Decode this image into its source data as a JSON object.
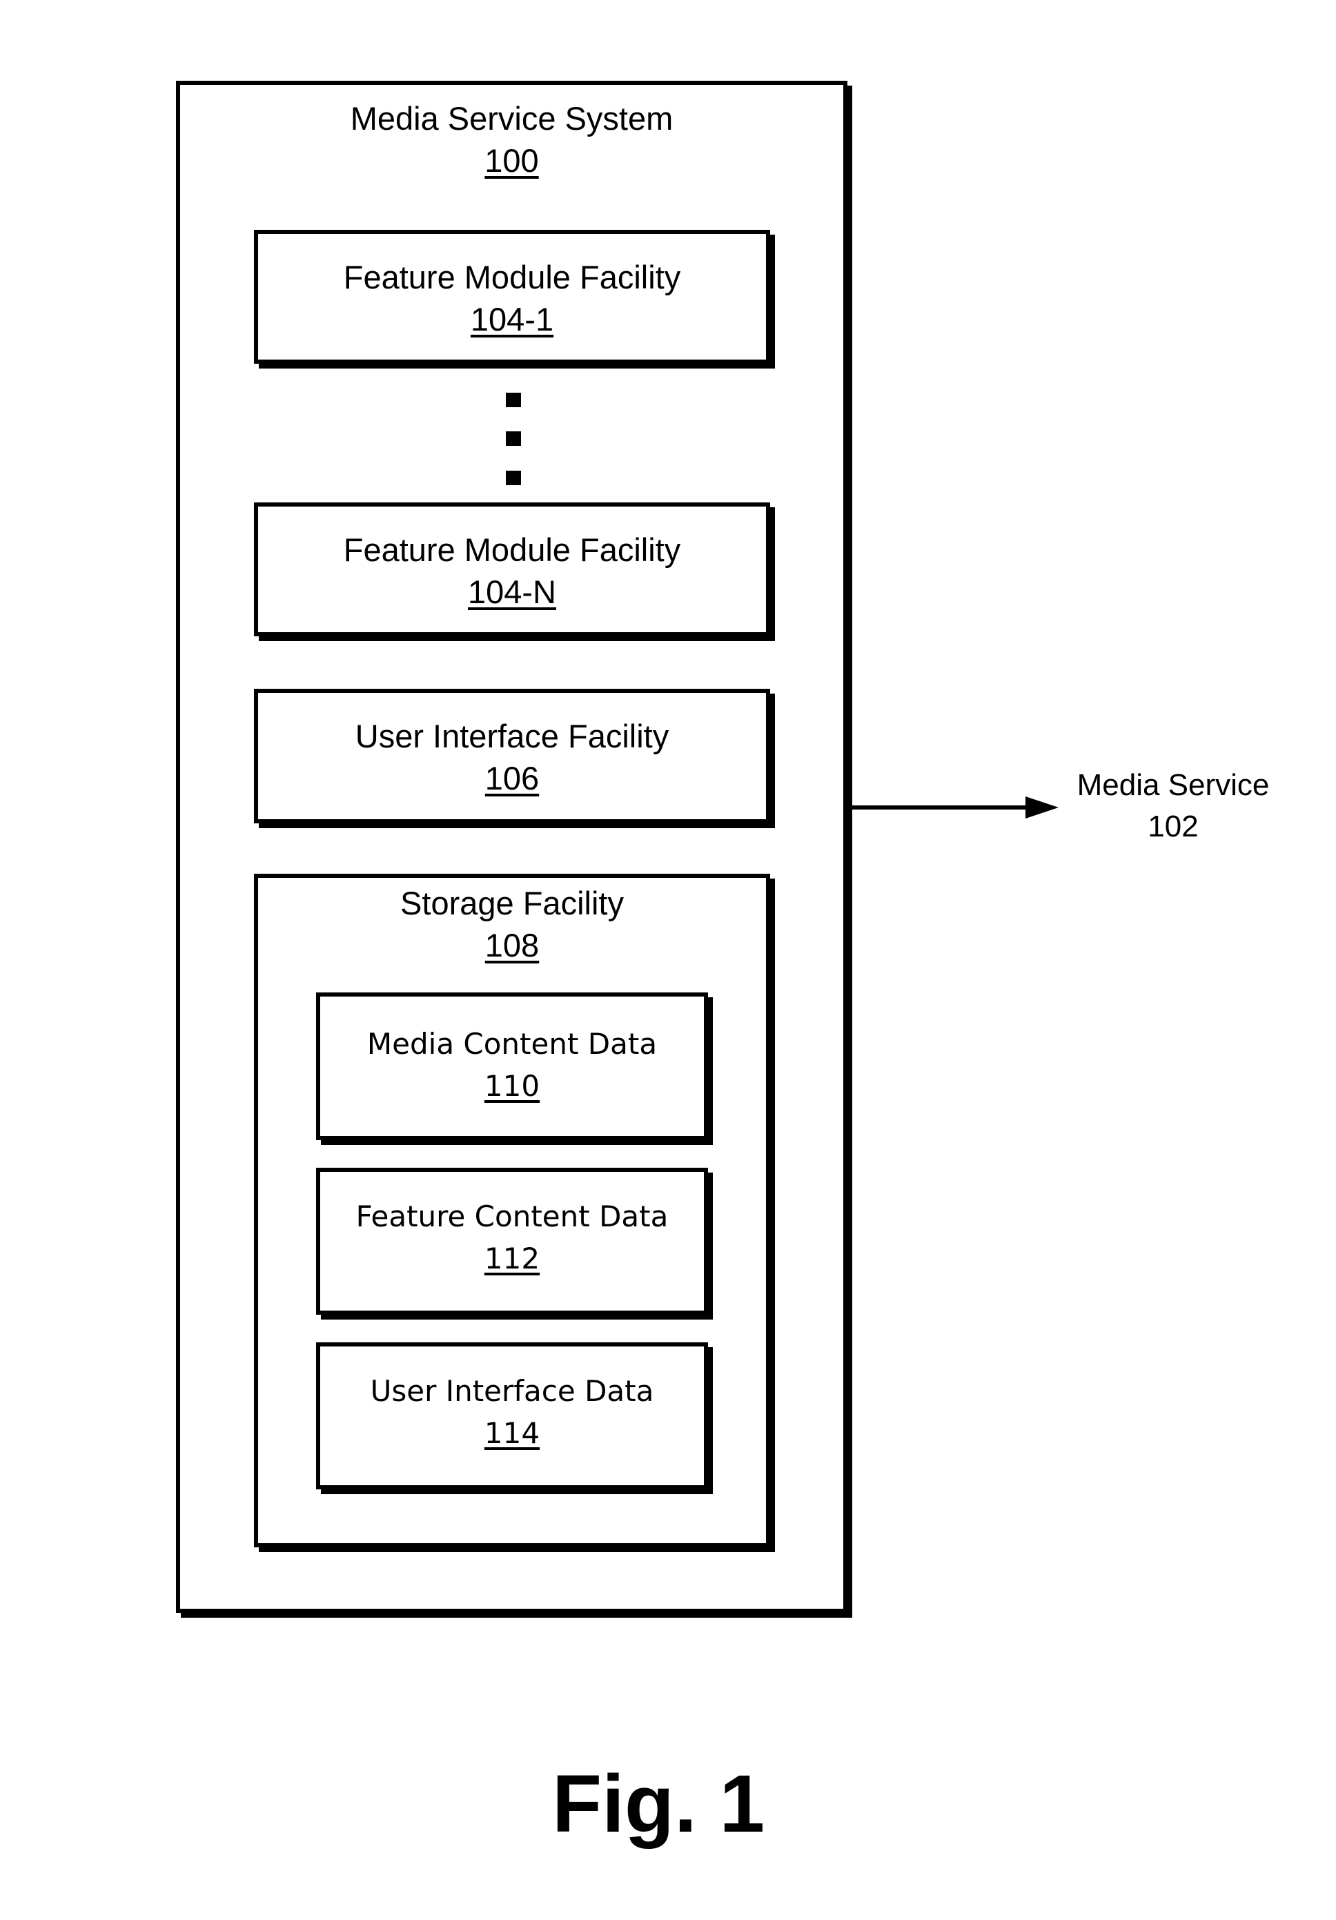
{
  "diagram": {
    "system": {
      "title": "Media Service System",
      "ref": "100"
    },
    "feature_module_first": {
      "title": "Feature Module Facility",
      "ref": "104-1"
    },
    "ellipsis": {
      "description": "vertical ellipsis of three square dots"
    },
    "feature_module_last": {
      "title": "Feature Module Facility",
      "ref": "104-N"
    },
    "user_interface_facility": {
      "title": "User Interface Facility",
      "ref": "106"
    },
    "storage_facility": {
      "title": "Storage Facility",
      "ref": "108",
      "items": [
        {
          "title": "Media Content Data",
          "ref": "110"
        },
        {
          "title": "Feature Content Data",
          "ref": "112"
        },
        {
          "title": "User Interface Data",
          "ref": "114"
        }
      ]
    },
    "external": {
      "title": "Media Service",
      "ref": "102",
      "connector": "arrow from Media Service System to Media Service"
    },
    "caption": "Fig. 1"
  }
}
